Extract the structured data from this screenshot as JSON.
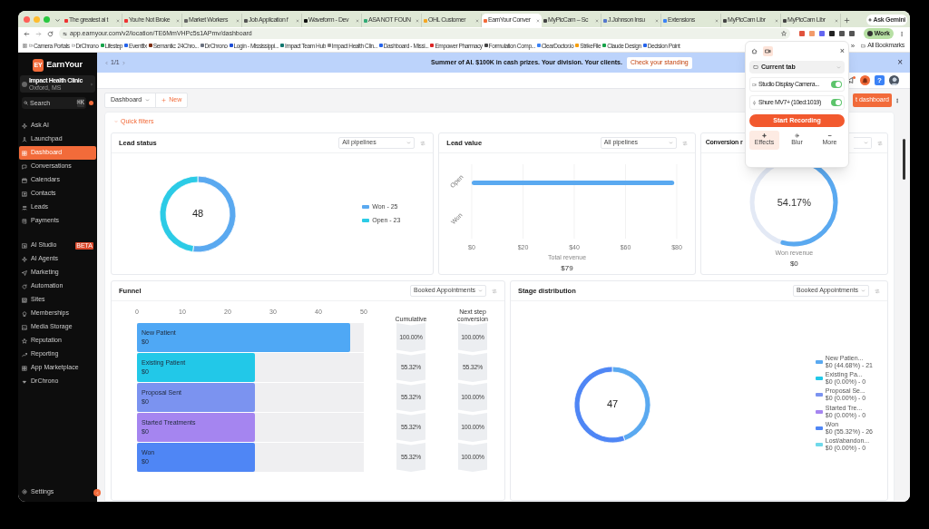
{
  "browser": {
    "tabs": [
      {
        "title": "The greatest ai t",
        "selected": false
      },
      {
        "title": "You're Not Broke",
        "selected": false
      },
      {
        "title": "Market Workers",
        "selected": false
      },
      {
        "title": "Job Application f",
        "selected": false
      },
      {
        "title": "Waveform - Dev",
        "selected": false
      },
      {
        "title": "ASA NOT FOUN",
        "selected": false
      },
      {
        "title": "OHL Customer",
        "selected": false
      },
      {
        "title": "EarnYour Conver",
        "selected": true
      },
      {
        "title": "MyPicCam – Sc",
        "selected": false
      },
      {
        "title": "J.Johnson Insu",
        "selected": false
      },
      {
        "title": "Extensions",
        "selected": false
      },
      {
        "title": "MyPicCam Libr",
        "selected": false
      },
      {
        "title": "MyPicCam Libr",
        "selected": false
      }
    ],
    "ask_button": "Ask Gemini",
    "url": "app.earnyour.com/v2/location/TE6MmVHPc5s1APmv/dashboard",
    "profile": "Work",
    "bookmarks": [
      {
        "label": "Camera Portals",
        "kind": "folder"
      },
      {
        "label": "DrChrono",
        "kind": "folder"
      },
      {
        "label": "Lifestep",
        "kind": "site"
      },
      {
        "label": "Eventfix",
        "kind": "site"
      },
      {
        "label": "Semantic: 24Chro...",
        "kind": "site"
      },
      {
        "label": "DrChrono",
        "kind": "site"
      },
      {
        "label": "Login - Mississippi...",
        "kind": "site"
      },
      {
        "label": "Impact Team Hub",
        "kind": "site"
      },
      {
        "label": "Impact Health Clin...",
        "kind": "site"
      },
      {
        "label": "Dashboard - Missi...",
        "kind": "site"
      },
      {
        "label": "Empower Pharmacy",
        "kind": "site"
      },
      {
        "label": "Formulation Comp...",
        "kind": "site"
      },
      {
        "label": "ClearDoctor.io",
        "kind": "site"
      },
      {
        "label": "StrikeFile",
        "kind": "site"
      },
      {
        "label": "Claude Design",
        "kind": "site"
      },
      {
        "label": "Decision Point",
        "kind": "site"
      }
    ],
    "more_bookmarks": "»",
    "all_bookmarks": "All Bookmarks"
  },
  "sidebar": {
    "logo_mark": "EY",
    "logo_text": "EarnYour",
    "account": {
      "name": "Impact Health Clinic",
      "location": "Oxford, MS"
    },
    "search": {
      "placeholder": "Search",
      "shortcut": "⌘K"
    },
    "sections": [
      {
        "items": [
          {
            "label": "Ask AI",
            "selected": false
          },
          {
            "label": "Launchpad",
            "selected": false
          },
          {
            "label": "Dashboard",
            "selected": true
          },
          {
            "label": "Conversations",
            "selected": false
          },
          {
            "label": "Calendars",
            "selected": false
          },
          {
            "label": "Contacts",
            "selected": false
          },
          {
            "label": "Leads",
            "selected": false
          },
          {
            "label": "Payments",
            "selected": false
          }
        ]
      },
      {
        "items": [
          {
            "label": "AI Studio",
            "selected": false,
            "badge": "BETA"
          },
          {
            "label": "AI Agents",
            "selected": false
          },
          {
            "label": "Marketing",
            "selected": false
          },
          {
            "label": "Automation",
            "selected": false
          },
          {
            "label": "Sites",
            "selected": false
          },
          {
            "label": "Memberships",
            "selected": false
          },
          {
            "label": "Media Storage",
            "selected": false
          },
          {
            "label": "Reputation",
            "selected": false
          },
          {
            "label": "Reporting",
            "selected": false
          },
          {
            "label": "App Marketplace",
            "selected": false
          },
          {
            "label": "DrChrono",
            "selected": false
          }
        ]
      }
    ],
    "settings": "Settings"
  },
  "banner": {
    "pager": "1/1",
    "message": "Summer of AI. $100K in cash prizes. Your division. Your clients.",
    "button": "Check your standing",
    "close": "×"
  },
  "header": {
    "help": "?"
  },
  "toolbar": {
    "dashboard_select": "Dashboard",
    "new_button": "New",
    "edit_button": "t dashboard"
  },
  "quick_filters": "Quick filters",
  "lead_status": {
    "title": "Lead status",
    "filter": "All pipelines",
    "total": "48",
    "chart_data": {
      "type": "donut",
      "values": [
        52.08,
        47.92
      ]
    },
    "legend": [
      {
        "label": "Won - 25",
        "color": "#5aa9f0"
      },
      {
        "label": "Open - 23",
        "color": "#2ccbe6"
      }
    ]
  },
  "lead_value": {
    "title": "Lead value",
    "filter": "All pipelines",
    "chart_data": {
      "type": "bar",
      "orientation": "horizontal",
      "grid": true,
      "categories": [
        "Open",
        "Won"
      ],
      "values": [
        79,
        0
      ],
      "xlabel": "Total revenue",
      "xlim": [
        0,
        80
      ],
      "xticks": [
        {
          "value": 0,
          "label": "$0"
        },
        {
          "value": 20,
          "label": "$20"
        },
        {
          "value": 40,
          "label": "$40"
        },
        {
          "value": 60,
          "label": "$60"
        },
        {
          "value": 80,
          "label": "$80"
        }
      ]
    },
    "total": "$79"
  },
  "conversion": {
    "title": "Conversion r",
    "level": 0.5417,
    "reading": "54.17%",
    "caption": "Won revenue",
    "amount": "$0"
  },
  "funnel": {
    "title": "Funnel",
    "filter": "Booked Appointments",
    "columns": [
      "Cumulative",
      "Next step conversion"
    ],
    "chart_data": {
      "type": "bar",
      "orientation": "horizontal",
      "categories": [
        "New Patient",
        "Existing Patient",
        "Proposal Sent",
        "Started Treatments",
        "Won"
      ],
      "values": [
        47,
        26,
        26,
        26,
        26
      ],
      "xlim": [
        0,
        50
      ],
      "xticks": [
        0,
        10,
        20,
        30,
        40,
        50
      ]
    },
    "rows": [
      {
        "amount": "$0",
        "cumulative": "100.00%",
        "next_step": "100.00%",
        "color": "#4fa8f5"
      },
      {
        "amount": "$0",
        "cumulative": "55.32%",
        "next_step": "55.32%",
        "color": "#22c8e8"
      },
      {
        "amount": "$0",
        "cumulative": "55.32%",
        "next_step": "100.00%",
        "color": "#7b93f0"
      },
      {
        "amount": "$0",
        "cumulative": "55.32%",
        "next_step": "100.00%",
        "color": "#a585f0"
      },
      {
        "amount": "$0",
        "cumulative": "55.32%",
        "next_step": "100.00%",
        "color": "#4f86f5"
      }
    ]
  },
  "stage_distribution": {
    "title": "Stage distribution",
    "filter": "Booked Appointments",
    "total": "47",
    "chart_data": {
      "type": "donut",
      "values": [
        44.68,
        0,
        0,
        0,
        55.32,
        0
      ]
    },
    "legend": [
      {
        "label": "New Patien...",
        "detail": "$0 (44.68%) - 21",
        "color": "#5aa9f0"
      },
      {
        "label": "Existing Pa...",
        "detail": "$0 (0.00%) - 0",
        "color": "#22c8e8"
      },
      {
        "label": "Proposal Se...",
        "detail": "$0 (0.00%) - 0",
        "color": "#7b93f0"
      },
      {
        "label": "Started Tre...",
        "detail": "$0 (0.00%) - 0",
        "color": "#a585f0"
      },
      {
        "label": "Won",
        "detail": "$0 (55.32%) - 26",
        "color": "#4f86f5"
      },
      {
        "label": "Lost/abandon...",
        "detail": "$0 (0.00%) - 0",
        "color": "#6fd9ea"
      }
    ]
  },
  "recorder_popup": {
    "tabs": [
      {
        "kind": "home",
        "selected": false
      },
      {
        "kind": "camera",
        "selected": true
      }
    ],
    "close": "×",
    "source": "Current tab",
    "devices": [
      {
        "kind": "camera",
        "label": "Studio Display Camera...",
        "on": true
      },
      {
        "kind": "microphone",
        "label": "Shure MV7+ (10ed:1019)",
        "on": true
      }
    ],
    "record_button": "Start Recording",
    "modes": [
      {
        "label": "Effects",
        "selected": true
      },
      {
        "label": "Blur",
        "selected": false
      },
      {
        "label": "More",
        "selected": false
      }
    ]
  }
}
